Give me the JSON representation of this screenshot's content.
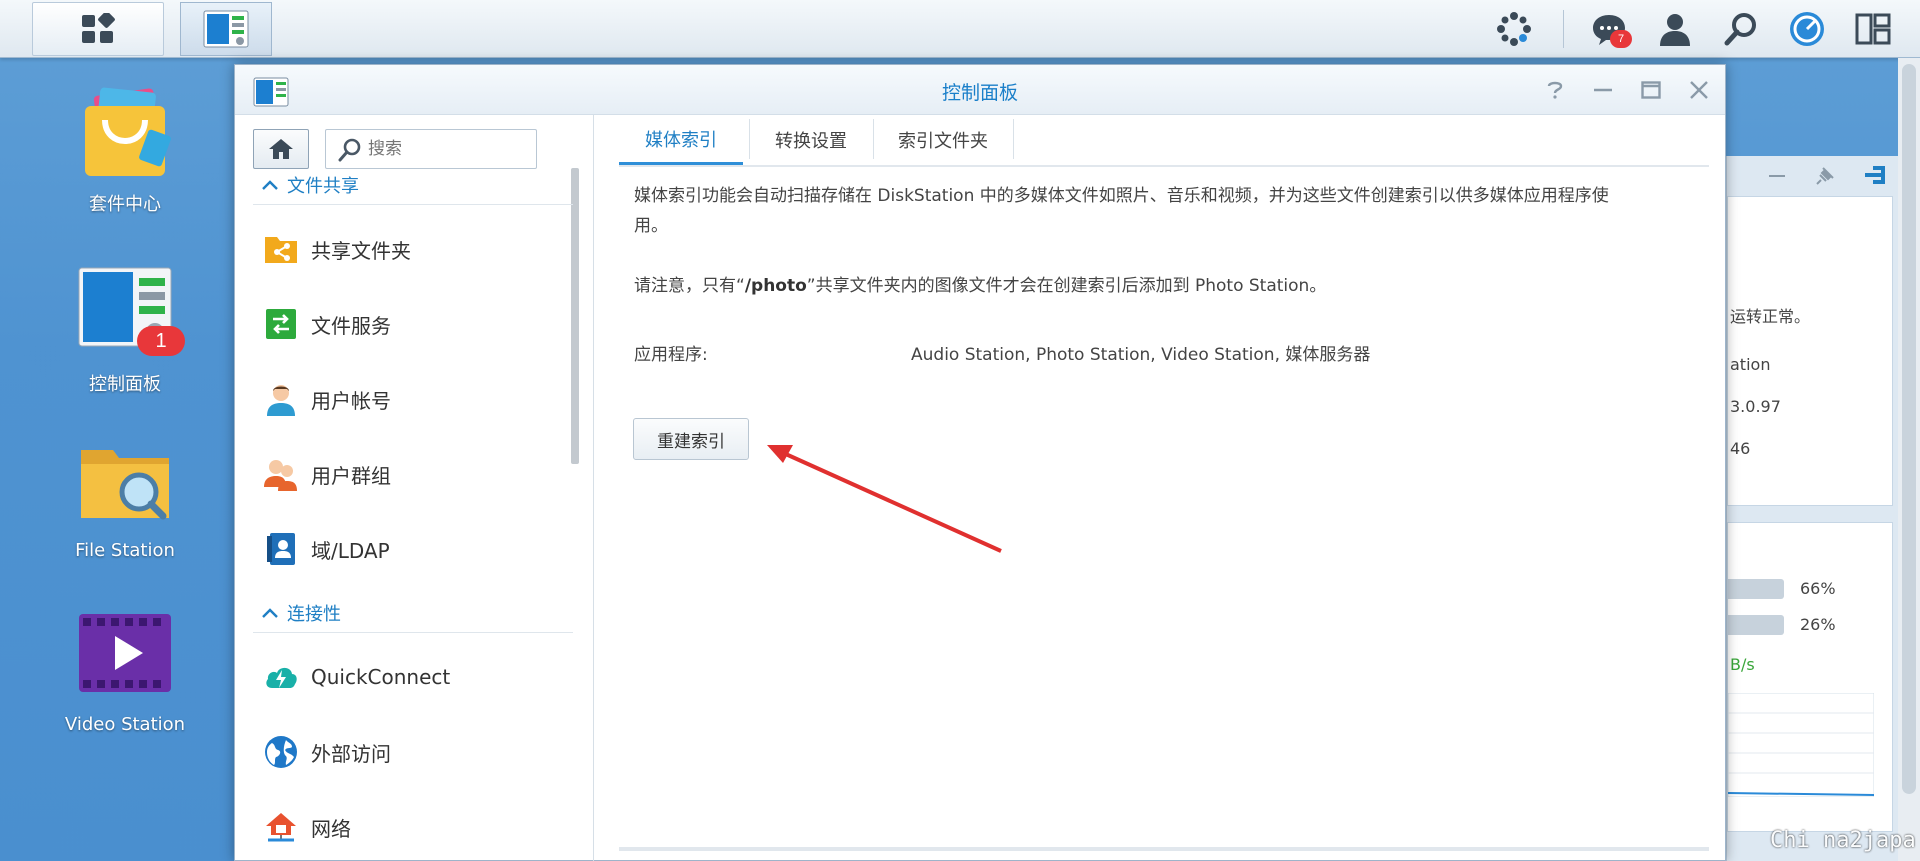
{
  "taskbar": {
    "notification_count": "7"
  },
  "desktop": {
    "icons": [
      {
        "label": "套件中心"
      },
      {
        "label": "控制面板",
        "badge": "1"
      },
      {
        "label": "File Station"
      },
      {
        "label": "Video Station"
      }
    ]
  },
  "window": {
    "title": "控制面板"
  },
  "sidebar": {
    "search_placeholder": "搜索",
    "sections": [
      {
        "label": "文件共享"
      },
      {
        "label": "连接性"
      }
    ],
    "items": [
      {
        "label": "共享文件夹",
        "icon": "shared-folder-icon"
      },
      {
        "label": "文件服务",
        "icon": "file-services-icon"
      },
      {
        "label": "用户帐号",
        "icon": "user-icon"
      },
      {
        "label": "用户群组",
        "icon": "group-icon"
      },
      {
        "label": "域/LDAP",
        "icon": "ldap-icon"
      },
      {
        "label": "QuickConnect",
        "icon": "quickconnect-icon"
      },
      {
        "label": "外部访问",
        "icon": "globe-icon"
      },
      {
        "label": "网络",
        "icon": "network-icon"
      }
    ]
  },
  "tabs": [
    {
      "label": "媒体索引",
      "active": true
    },
    {
      "label": "转换设置",
      "active": false
    },
    {
      "label": "索引文件夹",
      "active": false
    }
  ],
  "content": {
    "desc_line1": "媒体索引功能会自动扫描存储在 DiskStation 中的多媒体文件如照片、音乐和视频，并为这些文件创建索引以供多媒体应用程序使",
    "desc_line2": "用。",
    "note_prefix": "请注意，只有“",
    "note_bold": "/photo",
    "note_suffix": "”共享文件夹内的图像文件才会在创建索引后添加到 Photo Station。",
    "apps_label": "应用程序:",
    "apps_value": "Audio Station, Photo Station, Video Station, 媒体服务器",
    "rebuild_button": "重建索引"
  },
  "background_widget": {
    "status_fragment": "运转正常。",
    "line1": "ation",
    "line2": "3.0.97",
    "line3": "46",
    "cpu_percent": "66%",
    "ram_percent": "26%",
    "net_fragment": "B/s"
  },
  "watermark": "Chi na2japa",
  "colors": {
    "accent": "#1f7fc4",
    "desktop_bg": "#4f93d1",
    "badge": "#e8373a",
    "arrow": "#e0302f"
  }
}
